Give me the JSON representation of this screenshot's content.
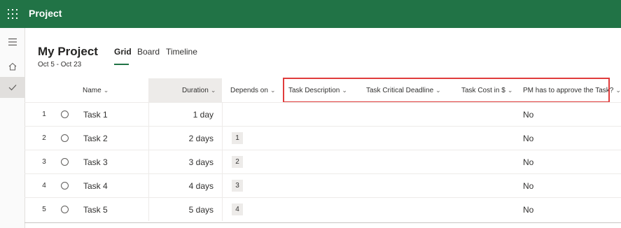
{
  "app": {
    "title": "Project"
  },
  "rail": {
    "menu_icon": "hamburger-icon",
    "home_icon": "home-icon",
    "check_icon": "checkmark-icon"
  },
  "project": {
    "name": "My Project",
    "dates": "Oct 5 - Oct 23"
  },
  "tabs": [
    {
      "label": "Grid",
      "active": true
    },
    {
      "label": "Board",
      "active": false
    },
    {
      "label": "Timeline",
      "active": false
    }
  ],
  "columns": {
    "name": "Name",
    "duration": "Duration",
    "depends_on": "Depends on",
    "task_description": "Task Description",
    "task_critical_deadline": "Task Critical Deadline",
    "task_cost": "Task Cost in $",
    "pm_approve": "PM has to approve the Task?"
  },
  "rows": [
    {
      "num": "1",
      "name": "Task 1",
      "duration": "1 day",
      "depends_on": "",
      "pm_approve": "No"
    },
    {
      "num": "2",
      "name": "Task 2",
      "duration": "2 days",
      "depends_on": "1",
      "pm_approve": "No"
    },
    {
      "num": "3",
      "name": "Task 3",
      "duration": "3 days",
      "depends_on": "2",
      "pm_approve": "No"
    },
    {
      "num": "4",
      "name": "Task 4",
      "duration": "4 days",
      "depends_on": "3",
      "pm_approve": "No"
    },
    {
      "num": "5",
      "name": "Task 5",
      "duration": "5 days",
      "depends_on": "4",
      "pm_approve": "No"
    }
  ],
  "colors": {
    "brand": "#217346",
    "highlight_box": "#e03c3c"
  }
}
